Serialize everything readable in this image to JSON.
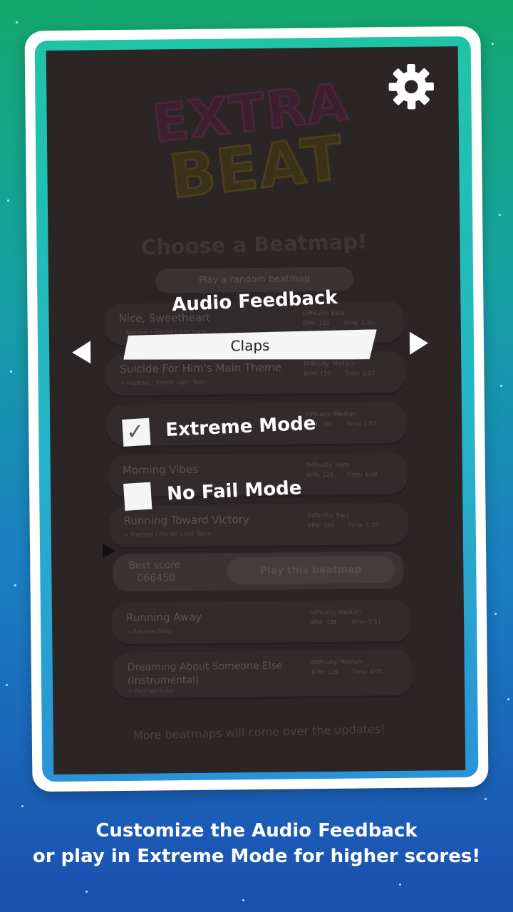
{
  "app": {
    "logo_line1": "EXTRA",
    "logo_line2": "BEAT",
    "settings_icon": "gear-icon"
  },
  "beatmap_screen": {
    "title": "Choose a Beatmap!",
    "random_button": "Play a random beatmap",
    "beatmaps": [
      {
        "name": "Nice, Sweetheart",
        "sub": "> Raphael / Starbit Light Team",
        "difficulty": "Difficulty: Easy",
        "bpm": "BPM: 150",
        "time": "Time: 1:30"
      },
      {
        "name": "Suicide For Him's Main Theme",
        "sub": "> Raphael / Starbit Light Team",
        "difficulty": "Difficulty: Medium",
        "bpm": "BPM: 120",
        "time": "Time: 1:27"
      },
      {
        "name": "",
        "sub": "",
        "difficulty": "Difficulty: Medium",
        "bpm": "BPM: 100",
        "time": "Time: 1:57"
      },
      {
        "name": "Morning Vibes",
        "sub": "",
        "difficulty": "Difficulty: Hard",
        "bpm": "BPM: 120",
        "time": "Time: 1:38"
      },
      {
        "name": "Running Toward Victory",
        "sub": "> Raphael / Starbit Light Team",
        "difficulty": "Difficulty: Easy",
        "bpm": "BPM: 160",
        "time": "Time: 1:27"
      },
      {
        "name": "Running Away",
        "sub": "> Raphael Neko",
        "difficulty": "Difficulty: Medium",
        "bpm": "BPM: 128",
        "time": "Time: 2:51"
      },
      {
        "name": "Dreaming About Someone Else (Instrumental)",
        "sub": "> Raphael Neko",
        "difficulty": "Difficulty: Medium",
        "bpm": "BPM: 128",
        "time": "Time: 4:05"
      }
    ],
    "selected": {
      "best_score_label": "Best score",
      "best_score_value": "066450",
      "play_button": "Play this beatmap"
    },
    "footer_note": "More beatmaps will come over the updates!"
  },
  "settings_overlay": {
    "audio_feedback_title": "Audio Feedback",
    "audio_feedback_value": "Claps",
    "prev_icon": "triangle-left-icon",
    "next_icon": "triangle-right-icon",
    "extreme_mode": {
      "label": "Extreme Mode",
      "checked": true
    },
    "no_fail_mode": {
      "label": "No Fail Mode",
      "checked": false
    }
  },
  "caption": {
    "line1": "Customize the Audio Feedback",
    "line2": "or play in Extreme Mode for higher scores!"
  },
  "colors": {
    "bg_top": "#14a66d",
    "bg_bottom": "#1b4fb0",
    "frame": "#ffffff",
    "screen_bg": "#2b2526"
  }
}
